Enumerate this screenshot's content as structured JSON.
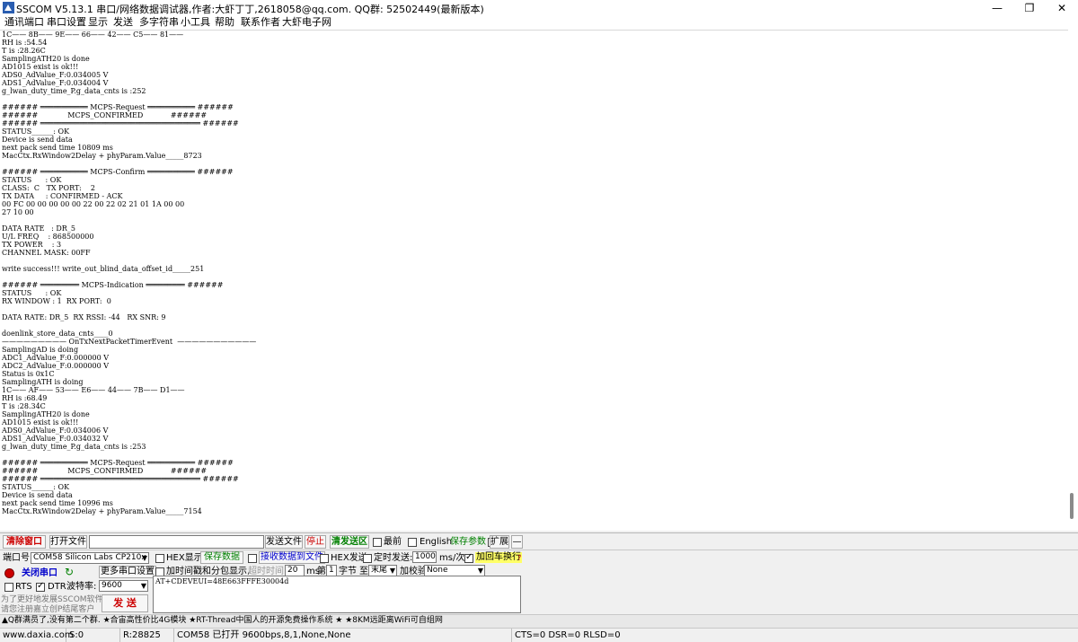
{
  "window": {
    "title": "SSCOM V5.13.1 串口/网络数据调试器,作者:大虾丁丁,2618058@qq.com. QQ群: 52502449(最新版本)",
    "minimize": "—",
    "maximize": "❐",
    "close": "✕"
  },
  "menu": [
    "通讯端口",
    "串口设置",
    "显示",
    "发送",
    "多字符串",
    "小工具",
    "帮助",
    "联系作者",
    "大虾电子网"
  ],
  "console": {
    "lines": [
      "1C—— 8B—— 9E—— 66—— 42—— C5—— 81——",
      "RH is :54.54",
      "T is :28.26C",
      "SamplingATH20 is done",
      "AD1015 exist is ok!!!",
      "ADS0_AdValue_F:0.034005 V",
      "ADS1_AdValue_F:0.034004 V",
      "g_lwan_duty_time_P.g_data_cnts is :252",
      "",
      "###### ═══════════ MCPS-Request ═══════════ ######",
      "######             MCPS_CONFIRMED            ######",
      "###### ═════════════════════════════════════ ######",
      "STATUS______: OK",
      "Device is send data",
      "next pack send time 10809 ms",
      "MacCtx.RxWindow2Delay + phyParam.Value_____8723",
      "",
      "###### ═══════════ MCPS-Confirm ═══════════ ######",
      "STATUS      : OK",
      "CLASS:  C   TX PORT:    2",
      "TX DATA     : CONFIRMED - ACK",
      "00 FC 00 00 00 00 00 22 00 22 02 21 01 1A 00 00",
      "27 10 00",
      "",
      "DATA RATE   : DR_5",
      "U/L FREQ    : 868500000",
      "TX POWER    : 3",
      "CHANNEL MASK: 00FF",
      "",
      "write success!!! write_out_blind_data_offset_id_____251",
      "",
      "###### ═════════ MCPS-Indication ═════════ ######",
      "STATUS      : OK",
      "RX WINDOW : 1  RX PORT:  0",
      "",
      "DATA RATE: DR_5  RX RSSI: -44   RX SNR: 9",
      "",
      "doenlink_store_data_cnts____0",
      "————————— OnTxNextPacketTimerEvent  ———————————",
      "SamplingAD is doing",
      "ADC1_AdValue_F:0.000000 V",
      "ADC2_AdValue_F:0.000000 V",
      "Status is 0x1C",
      "SamplingATH is doing",
      "1C—— AF—— 53—— E6—— 44—— 7B—— D1——",
      "RH is :68.49",
      "T is :28.34C",
      "SamplingATH20 is done",
      "AD1015 exist is ok!!!",
      "ADS0_AdValue_F:0.034006 V",
      "ADS1_AdValue_F:0.034032 V",
      "g_lwan_duty_time_P.g_data_cnts is :253",
      "",
      "###### ═══════════ MCPS-Request ═══════════ ######",
      "######             MCPS_CONFIRMED            ######",
      "###### ═════════════════════════════════════ ######",
      "STATUS______: OK",
      "Device is send data",
      "next pack send time 10996 ms",
      "MacCtx.RxWindow2Delay + phyParam.Value_____7154"
    ]
  },
  "toolbar": {
    "clear_window": "清除窗口",
    "open_file": "打开文件",
    "send_file": "发送文件",
    "stop": "停止",
    "clear_send": "清发送区",
    "topmost": "最前",
    "english": "English",
    "save_params": "保存参数",
    "expand": "扩展",
    "collapse": "—"
  },
  "port": {
    "port_label": "端口号",
    "port_value": "COM58 Silicon Labs CP210x",
    "close_port": "关闭串口",
    "more_settings": "更多串口设置",
    "rts": "RTS",
    "dtr": "DTR",
    "baud_label": "波特率:",
    "baud_value": "9600",
    "promo1": "为了更好地发展SSCOM软件",
    "promo2": "请您注册嘉立创P结尾客户",
    "send_button": "发 送"
  },
  "options": {
    "hex_display": "HEX显示",
    "save_data": "保存数据",
    "recv_to_file": "接收数据到文件",
    "hex_send": "HEX发送",
    "timed_send": "定时发送:",
    "interval_value": "1000",
    "interval_unit": "ms/次",
    "append_crlf": "加回车换行",
    "timestamp": "加时间戳和分包显示,",
    "timeout_label": "超时时间:",
    "timeout_value": "20",
    "ms_label": "ms",
    "nth_label": "第",
    "nth_value": "1",
    "byte_label": "字节",
    "to_label": "至",
    "end_value": "末尾",
    "checksum_label": "加校验",
    "checksum_value": "None"
  },
  "send_area": {
    "text": "AT+CDEVEUI=48E663FFFE30004d"
  },
  "ticker": "▲Q群满员了,没有第二个群. ★合宙高性价比4G模块 ★RT-Thread中国人的开源免费操作系统 ★ ★8KM远距离WiFi可自组网",
  "status": {
    "website": "www.daxia.com",
    "s": "S:0",
    "r": "R:28825",
    "port_info": "COM58 已打开  9600bps,8,1,None,None",
    "signals": "CTS=0 DSR=0 RLSD=0"
  },
  "colors": {
    "accent_red": "#cc0000",
    "accent_green": "#008000",
    "accent_blue": "#0000cc",
    "highlight_yellow": "#ffff66"
  }
}
